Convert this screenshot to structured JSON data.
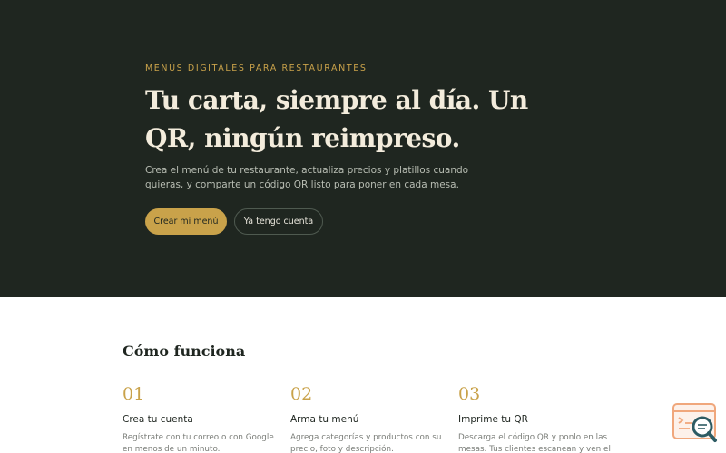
{
  "hero": {
    "eyebrow": "MENÚS DIGITALES PARA RESTAURANTES",
    "headline": "Tu carta, siempre al día. Un QR, ningún reimpreso.",
    "subtitle": "Crea el menú de tu restaurante, actualiza precios y platillos cuando quieras, y comparte un código QR listo para poner en cada mesa.",
    "primary_cta": "Crear mi menú",
    "secondary_cta": "Ya tengo cuenta"
  },
  "how_it_works": {
    "title": "Cómo funciona",
    "steps": [
      {
        "number": "01",
        "title": "Crea tu cuenta",
        "description": "Regístrate con tu correo o con Google en menos de un minuto."
      },
      {
        "number": "02",
        "title": "Arma tu menú",
        "description": "Agrega categorías y productos con su precio, foto y descripción."
      },
      {
        "number": "03",
        "title": "Imprime tu QR",
        "description": "Descarga el código QR y ponlo en las mesas. Tus clientes escanean y ven el"
      }
    ]
  },
  "widget": {
    "icon": "search-chat-icon"
  },
  "colors": {
    "hero_bg": "#1f2620",
    "accent": "#c9a24a",
    "widget_orange": "#f0a77c",
    "widget_teal": "#2d5b63"
  }
}
